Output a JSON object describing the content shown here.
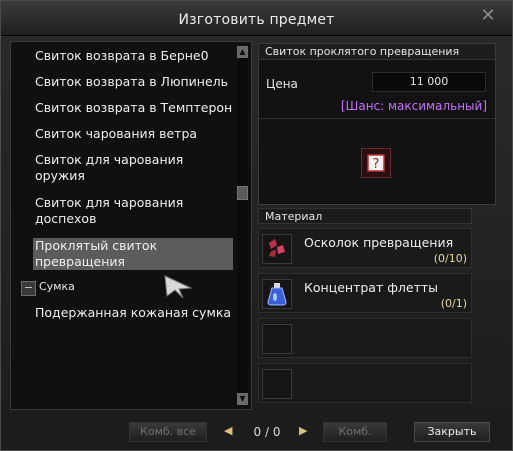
{
  "window": {
    "title": "Изготовить предмет",
    "close_glyph": "✕"
  },
  "list": {
    "items": [
      {
        "label": "Свиток возврата в Берне0"
      },
      {
        "label": "Свиток возврата в Люпинель"
      },
      {
        "label": "Свиток возврата в Темптерон"
      },
      {
        "label": "Свиток чарования ветра"
      },
      {
        "label": "Свиток для чарования\nоружия"
      },
      {
        "label": "Свиток для чарования\nдоспехов"
      },
      {
        "label": "Проклятый свиток\nпревращения",
        "selected": true
      }
    ],
    "group": {
      "toggle": "−",
      "label": "Сумка"
    },
    "group_items": [
      {
        "label": "Подержанная кожаная сумка"
      }
    ]
  },
  "recipe": {
    "header": "Свиток проклятого превращения",
    "price_label": "Цена",
    "price_value": "11 000",
    "chance": "[Шанс: максимальный]",
    "result_icon": "cursed-scroll-icon"
  },
  "materials": {
    "header": "Материал",
    "rows": [
      {
        "name": "Осколок превращения",
        "count": "(0/10)",
        "icon": "transform-shard-icon"
      },
      {
        "name": "Концентрат флетты",
        "count": "(0/1)",
        "icon": "potion-flask-icon"
      },
      {
        "name": "",
        "count": ""
      },
      {
        "name": "",
        "count": ""
      }
    ]
  },
  "footer": {
    "combine_all": "Комб. все",
    "pager": "0 / 0",
    "combine": "Комб.",
    "close": "Закрыть"
  },
  "colors": {
    "chance": "#c770ff",
    "count": "#e8d8a0",
    "selected_bg": "#5c5c5c"
  }
}
